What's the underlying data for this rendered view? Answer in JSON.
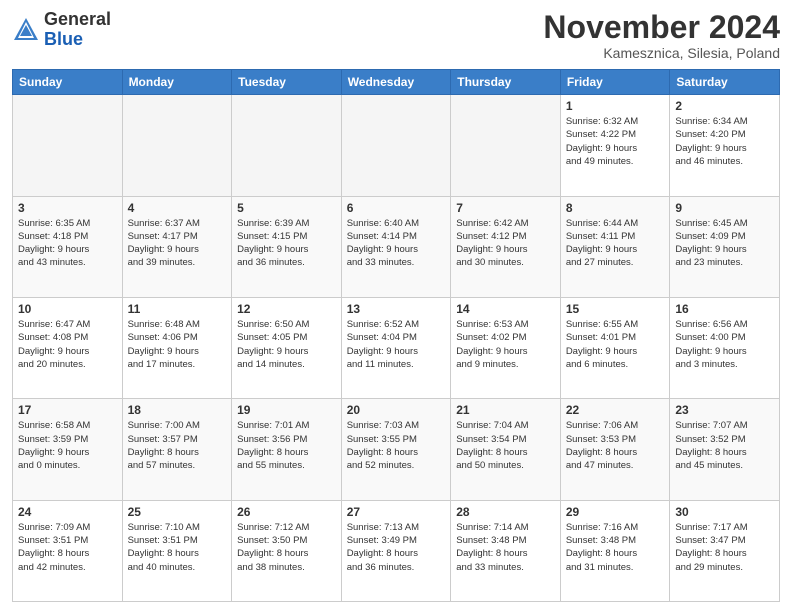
{
  "header": {
    "logo_general": "General",
    "logo_blue": "Blue",
    "month_title": "November 2024",
    "location": "Kamesznica, Silesia, Poland"
  },
  "days_of_week": [
    "Sunday",
    "Monday",
    "Tuesday",
    "Wednesday",
    "Thursday",
    "Friday",
    "Saturday"
  ],
  "weeks": [
    [
      {
        "day": "",
        "info": ""
      },
      {
        "day": "",
        "info": ""
      },
      {
        "day": "",
        "info": ""
      },
      {
        "day": "",
        "info": ""
      },
      {
        "day": "",
        "info": ""
      },
      {
        "day": "1",
        "info": "Sunrise: 6:32 AM\nSunset: 4:22 PM\nDaylight: 9 hours\nand 49 minutes."
      },
      {
        "day": "2",
        "info": "Sunrise: 6:34 AM\nSunset: 4:20 PM\nDaylight: 9 hours\nand 46 minutes."
      }
    ],
    [
      {
        "day": "3",
        "info": "Sunrise: 6:35 AM\nSunset: 4:18 PM\nDaylight: 9 hours\nand 43 minutes."
      },
      {
        "day": "4",
        "info": "Sunrise: 6:37 AM\nSunset: 4:17 PM\nDaylight: 9 hours\nand 39 minutes."
      },
      {
        "day": "5",
        "info": "Sunrise: 6:39 AM\nSunset: 4:15 PM\nDaylight: 9 hours\nand 36 minutes."
      },
      {
        "day": "6",
        "info": "Sunrise: 6:40 AM\nSunset: 4:14 PM\nDaylight: 9 hours\nand 33 minutes."
      },
      {
        "day": "7",
        "info": "Sunrise: 6:42 AM\nSunset: 4:12 PM\nDaylight: 9 hours\nand 30 minutes."
      },
      {
        "day": "8",
        "info": "Sunrise: 6:44 AM\nSunset: 4:11 PM\nDaylight: 9 hours\nand 27 minutes."
      },
      {
        "day": "9",
        "info": "Sunrise: 6:45 AM\nSunset: 4:09 PM\nDaylight: 9 hours\nand 23 minutes."
      }
    ],
    [
      {
        "day": "10",
        "info": "Sunrise: 6:47 AM\nSunset: 4:08 PM\nDaylight: 9 hours\nand 20 minutes."
      },
      {
        "day": "11",
        "info": "Sunrise: 6:48 AM\nSunset: 4:06 PM\nDaylight: 9 hours\nand 17 minutes."
      },
      {
        "day": "12",
        "info": "Sunrise: 6:50 AM\nSunset: 4:05 PM\nDaylight: 9 hours\nand 14 minutes."
      },
      {
        "day": "13",
        "info": "Sunrise: 6:52 AM\nSunset: 4:04 PM\nDaylight: 9 hours\nand 11 minutes."
      },
      {
        "day": "14",
        "info": "Sunrise: 6:53 AM\nSunset: 4:02 PM\nDaylight: 9 hours\nand 9 minutes."
      },
      {
        "day": "15",
        "info": "Sunrise: 6:55 AM\nSunset: 4:01 PM\nDaylight: 9 hours\nand 6 minutes."
      },
      {
        "day": "16",
        "info": "Sunrise: 6:56 AM\nSunset: 4:00 PM\nDaylight: 9 hours\nand 3 minutes."
      }
    ],
    [
      {
        "day": "17",
        "info": "Sunrise: 6:58 AM\nSunset: 3:59 PM\nDaylight: 9 hours\nand 0 minutes."
      },
      {
        "day": "18",
        "info": "Sunrise: 7:00 AM\nSunset: 3:57 PM\nDaylight: 8 hours\nand 57 minutes."
      },
      {
        "day": "19",
        "info": "Sunrise: 7:01 AM\nSunset: 3:56 PM\nDaylight: 8 hours\nand 55 minutes."
      },
      {
        "day": "20",
        "info": "Sunrise: 7:03 AM\nSunset: 3:55 PM\nDaylight: 8 hours\nand 52 minutes."
      },
      {
        "day": "21",
        "info": "Sunrise: 7:04 AM\nSunset: 3:54 PM\nDaylight: 8 hours\nand 50 minutes."
      },
      {
        "day": "22",
        "info": "Sunrise: 7:06 AM\nSunset: 3:53 PM\nDaylight: 8 hours\nand 47 minutes."
      },
      {
        "day": "23",
        "info": "Sunrise: 7:07 AM\nSunset: 3:52 PM\nDaylight: 8 hours\nand 45 minutes."
      }
    ],
    [
      {
        "day": "24",
        "info": "Sunrise: 7:09 AM\nSunset: 3:51 PM\nDaylight: 8 hours\nand 42 minutes."
      },
      {
        "day": "25",
        "info": "Sunrise: 7:10 AM\nSunset: 3:51 PM\nDaylight: 8 hours\nand 40 minutes."
      },
      {
        "day": "26",
        "info": "Sunrise: 7:12 AM\nSunset: 3:50 PM\nDaylight: 8 hours\nand 38 minutes."
      },
      {
        "day": "27",
        "info": "Sunrise: 7:13 AM\nSunset: 3:49 PM\nDaylight: 8 hours\nand 36 minutes."
      },
      {
        "day": "28",
        "info": "Sunrise: 7:14 AM\nSunset: 3:48 PM\nDaylight: 8 hours\nand 33 minutes."
      },
      {
        "day": "29",
        "info": "Sunrise: 7:16 AM\nSunset: 3:48 PM\nDaylight: 8 hours\nand 31 minutes."
      },
      {
        "day": "30",
        "info": "Sunrise: 7:17 AM\nSunset: 3:47 PM\nDaylight: 8 hours\nand 29 minutes."
      }
    ]
  ]
}
